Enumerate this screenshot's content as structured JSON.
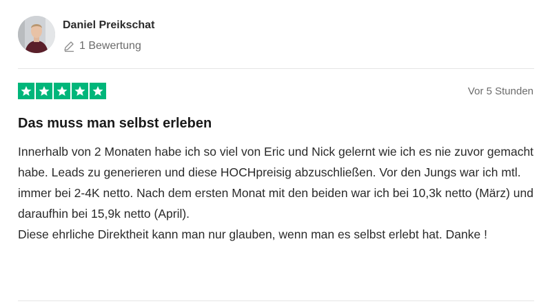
{
  "reviewer": {
    "name": "Daniel Preikschat",
    "review_count": "1 Bewertung"
  },
  "review": {
    "rating": 5,
    "rating_max": 5,
    "date": "Vor 5 Stunden",
    "title": "Das muss man selbst erleben",
    "paragraphs": [
      "Innerhalb von 2 Monaten habe ich so viel von Eric und Nick gelernt wie ich es nie zuvor gemacht habe. Leads zu generieren und diese HOCHpreisig abzuschließen. Vor den Jungs war ich mtl. immer bei 2-4K netto. Nach dem ersten Monat mit den beiden war ich bei 10,3k netto (März) und daraufhin bei 15,9k netto (April).",
      "Diese ehrliche Direktheit kann man nur glauben, wenn man es selbst erlebt hat. Danke !"
    ]
  },
  "colors": {
    "star_green": "#00b67a",
    "text_muted": "#6b6b6b",
    "divider": "#e5e5e5"
  },
  "icons": {
    "review_count": "pencil-icon",
    "rating": "star-icon"
  }
}
